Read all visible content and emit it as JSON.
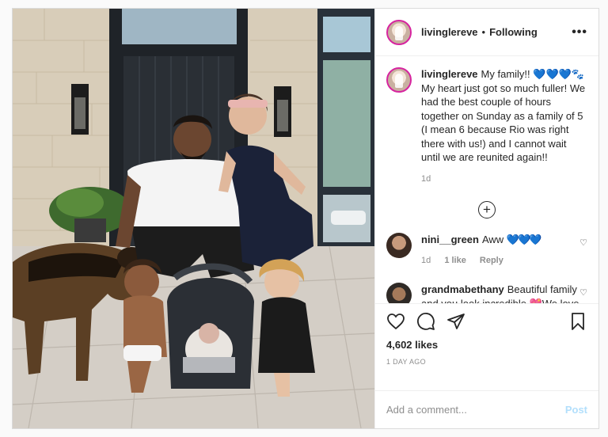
{
  "post": {
    "username": "livinglereve",
    "follow_status": "Following",
    "separator": "•",
    "more_icon": "more-horizontal-icon",
    "caption": {
      "username": "livinglereve",
      "text": "My family!! 💙💙💙🐾My heart just got so much fuller! We had the best couple of hours together on Sunday as a family of 5 (I mean 6 because Rio was right there with us!) and I cannot wait until we are reunited again!!",
      "age": "1d"
    },
    "load_more_icon": "plus-circle-icon",
    "comments": [
      {
        "username": "nini__green",
        "text": "Aww",
        "hearts": "💙💙💙",
        "age": "1d",
        "likes": "1 like",
        "reply": "Reply"
      },
      {
        "username": "grandmabethany",
        "text": "Beautiful family and you look incredible 💖We love you here in Utah🎀"
      }
    ],
    "likes": "4,602 likes",
    "date": "1 DAY AGO",
    "add_comment_placeholder": "Add a comment...",
    "post_button": "Post",
    "accent_color": "#3897f0"
  }
}
